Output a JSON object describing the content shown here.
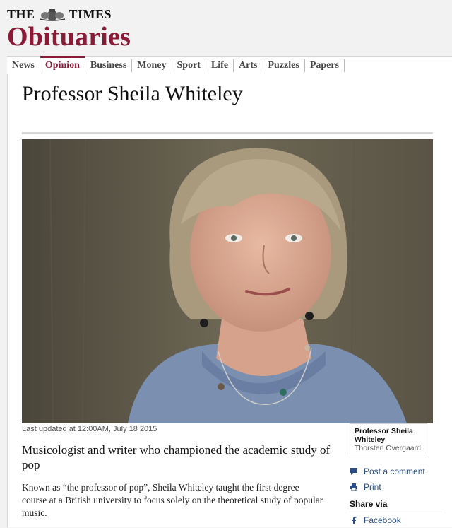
{
  "masthead": {
    "paper_name_left": "THE",
    "paper_name_right": "TIMES",
    "section": "Obituaries",
    "crest_icon": "royal-crest-icon"
  },
  "nav": {
    "items": [
      "News",
      "Opinion",
      "Business",
      "Money",
      "Sport",
      "Life",
      "Arts",
      "Puzzles",
      "Papers"
    ],
    "active": "Opinion",
    "active_color": "#8b1a36"
  },
  "article": {
    "headline": "Professor Sheila Whiteley",
    "updated": "Last updated at 12:00AM, July 18 2015",
    "standfirst": "Musicologist and writer who championed the academic study of pop",
    "body": "Known as “the professor of pop”, Sheila Whiteley taught the first degree course at a British university to focus solely on the theoretical study of popular music."
  },
  "photo_caption": {
    "name": "Professor Sheila Whiteley",
    "credit": "Thorsten Overgaard"
  },
  "sidebar": {
    "post_comment": "Post a comment",
    "print": "Print",
    "share_via": "Share via",
    "facebook": "Facebook",
    "link_color": "#2b4f86"
  }
}
